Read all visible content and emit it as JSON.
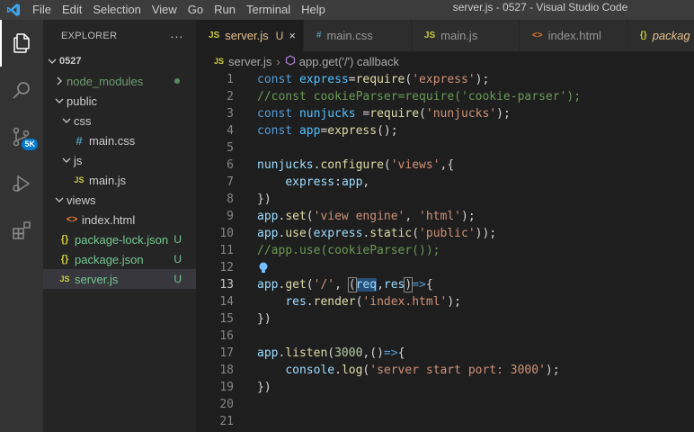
{
  "menu": [
    "File",
    "Edit",
    "Selection",
    "View",
    "Go",
    "Run",
    "Terminal",
    "Help"
  ],
  "window_title": "server.js - 0527 - Visual Studio Code",
  "activity": {
    "badge": "5K"
  },
  "explorer": {
    "title": "EXPLORER",
    "more": "···",
    "root": "0527",
    "items": [
      {
        "label": "node_modules",
        "type": "folder",
        "expanded": false,
        "depth": 1,
        "status": "dot"
      },
      {
        "label": "public",
        "type": "folder",
        "expanded": true,
        "depth": 1,
        "status": ""
      },
      {
        "label": "css",
        "type": "folder",
        "expanded": true,
        "depth": 2,
        "status": ""
      },
      {
        "label": "main.css",
        "type": "css",
        "depth": 3,
        "status": ""
      },
      {
        "label": "js",
        "type": "folder",
        "expanded": true,
        "depth": 2,
        "status": ""
      },
      {
        "label": "main.js",
        "type": "js",
        "depth": 3,
        "status": ""
      },
      {
        "label": "views",
        "type": "folder",
        "expanded": true,
        "depth": 1,
        "status": ""
      },
      {
        "label": "index.html",
        "type": "html",
        "depth": 2,
        "status": ""
      },
      {
        "label": "package-lock.json",
        "type": "json",
        "depth": 1,
        "status": "U"
      },
      {
        "label": "package.json",
        "type": "json",
        "depth": 1,
        "status": "U"
      },
      {
        "label": "server.js",
        "type": "js",
        "depth": 1,
        "status": "U",
        "selected": true
      }
    ]
  },
  "tabs": [
    {
      "label": "server.js",
      "icon": "JS",
      "mark": "U",
      "active": true
    },
    {
      "label": "main.css",
      "icon": "#",
      "active": false
    },
    {
      "label": "main.js",
      "icon": "JS",
      "active": false
    },
    {
      "label": "index.html",
      "icon": "<>",
      "active": false
    },
    {
      "label": "packag",
      "icon": "{}",
      "active": false
    }
  ],
  "tab_close": "×",
  "breadcrumb": {
    "file": "server.js",
    "symbol": "app.get('/') callback"
  },
  "code_lines": [
    {
      "n": "1",
      "tokens": [
        [
          "kw",
          "const "
        ],
        [
          "var",
          "express"
        ],
        [
          "op",
          "="
        ],
        [
          "fn",
          "require"
        ],
        [
          "op",
          "("
        ],
        [
          "str",
          "'express'"
        ],
        [
          "op",
          ");"
        ]
      ]
    },
    {
      "n": "2",
      "tokens": [
        [
          "cmt",
          "//const cookieParser=require('cookie-parser');"
        ]
      ]
    },
    {
      "n": "3",
      "tokens": [
        [
          "kw",
          "const "
        ],
        [
          "var",
          "nunjucks"
        ],
        [
          "op",
          " ="
        ],
        [
          "fn",
          "require"
        ],
        [
          "op",
          "("
        ],
        [
          "str",
          "'nunjucks'"
        ],
        [
          "op",
          ");"
        ]
      ]
    },
    {
      "n": "4",
      "tokens": [
        [
          "kw",
          "const "
        ],
        [
          "var",
          "app"
        ],
        [
          "op",
          "="
        ],
        [
          "fn",
          "express"
        ],
        [
          "op",
          "();"
        ]
      ]
    },
    {
      "n": "5",
      "tokens": []
    },
    {
      "n": "6",
      "tokens": [
        [
          "prop",
          "nunjucks"
        ],
        [
          "op",
          "."
        ],
        [
          "fn",
          "configure"
        ],
        [
          "op",
          "("
        ],
        [
          "str",
          "'views'"
        ],
        [
          "op",
          ",{"
        ]
      ]
    },
    {
      "n": "7",
      "tokens": [
        [
          "plain",
          "    "
        ],
        [
          "prop",
          "express"
        ],
        [
          "op",
          ":"
        ],
        [
          "prop",
          "app"
        ],
        [
          "op",
          ","
        ]
      ]
    },
    {
      "n": "8",
      "tokens": [
        [
          "op",
          "})"
        ]
      ]
    },
    {
      "n": "9",
      "tokens": [
        [
          "prop",
          "app"
        ],
        [
          "op",
          "."
        ],
        [
          "fn",
          "set"
        ],
        [
          "op",
          "("
        ],
        [
          "str",
          "'view engine'"
        ],
        [
          "op",
          ", "
        ],
        [
          "str",
          "'html'"
        ],
        [
          "op",
          ");"
        ]
      ]
    },
    {
      "n": "10",
      "tokens": [
        [
          "prop",
          "app"
        ],
        [
          "op",
          "."
        ],
        [
          "fn",
          "use"
        ],
        [
          "op",
          "("
        ],
        [
          "prop",
          "express"
        ],
        [
          "op",
          "."
        ],
        [
          "fn",
          "static"
        ],
        [
          "op",
          "("
        ],
        [
          "str",
          "'public'"
        ],
        [
          "op",
          "));"
        ]
      ]
    },
    {
      "n": "11",
      "tokens": [
        [
          "cmt",
          "//app.use(cookieParser());"
        ]
      ]
    },
    {
      "n": "12",
      "tokens": [],
      "bulb": true
    },
    {
      "n": "13",
      "current": true,
      "tokens": [
        [
          "prop",
          "app"
        ],
        [
          "op",
          "."
        ],
        [
          "fn",
          "get"
        ],
        [
          "op",
          "("
        ],
        [
          "str",
          "'/'"
        ],
        [
          "op",
          ", "
        ],
        [
          "brk",
          "("
        ],
        [
          "hl",
          "req"
        ],
        [
          "op",
          ","
        ],
        [
          "prop",
          "res"
        ],
        [
          "brk",
          ")"
        ],
        [
          "kw",
          "=>"
        ],
        [
          "op",
          "{"
        ]
      ]
    },
    {
      "n": "14",
      "tokens": [
        [
          "plain",
          "    "
        ],
        [
          "prop",
          "res"
        ],
        [
          "op",
          "."
        ],
        [
          "fn",
          "render"
        ],
        [
          "op",
          "("
        ],
        [
          "str",
          "'index.html'"
        ],
        [
          "op",
          ");"
        ]
      ]
    },
    {
      "n": "15",
      "tokens": [
        [
          "op",
          "})"
        ]
      ]
    },
    {
      "n": "16",
      "tokens": []
    },
    {
      "n": "17",
      "tokens": [
        [
          "prop",
          "app"
        ],
        [
          "op",
          "."
        ],
        [
          "fn",
          "listen"
        ],
        [
          "op",
          "("
        ],
        [
          "num",
          "3000"
        ],
        [
          "op",
          ",()"
        ],
        [
          "kw",
          "=>"
        ],
        [
          "op",
          "{"
        ]
      ]
    },
    {
      "n": "18",
      "tokens": [
        [
          "plain",
          "    "
        ],
        [
          "prop",
          "console"
        ],
        [
          "op",
          "."
        ],
        [
          "fn",
          "log"
        ],
        [
          "op",
          "("
        ],
        [
          "str",
          "'server start port: 3000'"
        ],
        [
          "op",
          ");"
        ]
      ]
    },
    {
      "n": "19",
      "tokens": [
        [
          "op",
          "})"
        ]
      ]
    },
    {
      "n": "20",
      "tokens": []
    },
    {
      "n": "21",
      "tokens": []
    }
  ],
  "colors": {
    "accent": "#007acc",
    "git_untracked": "#73c991",
    "modified_tab": "#e2c08d"
  }
}
